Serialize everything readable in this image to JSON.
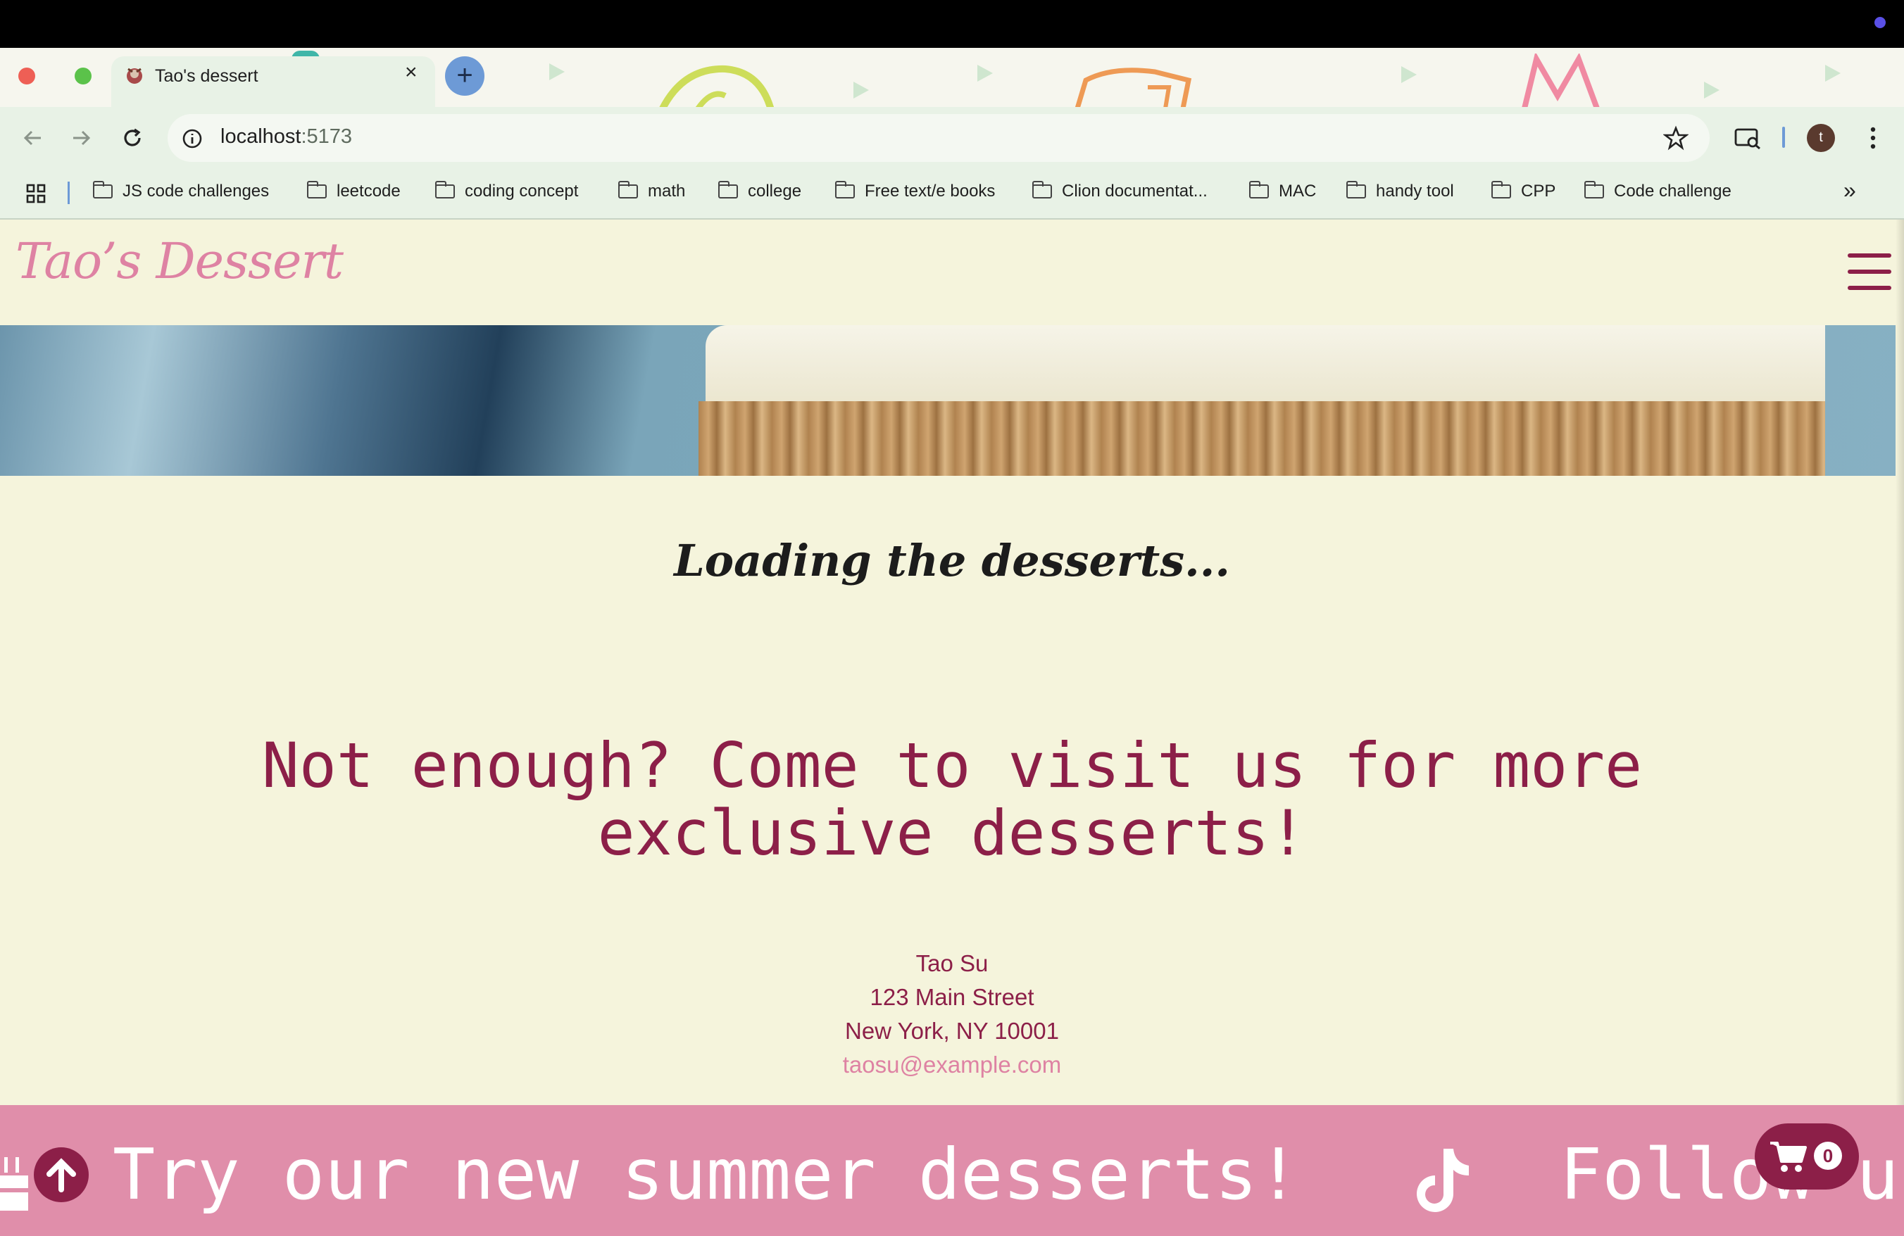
{
  "browser": {
    "tab_title": "Tao's dessert",
    "tab_close": "×",
    "new_tab": "+",
    "url_host": "localhost",
    "url_port": ":5173",
    "bookmarks": [
      "JS code challenges",
      "leetcode",
      "coding concept",
      "math",
      "college",
      "Free text/e books",
      "Clion documentat...",
      "MAC",
      "handy tool",
      "CPP",
      "Code challenge"
    ],
    "more_bookmarks": "»",
    "profile_initial": "t"
  },
  "site": {
    "brand": "Tao’s Dessert",
    "loading": "Loading the desserts...",
    "promo_line1": "Not enough? Come to visit us for more",
    "promo_line2": "exclusive desserts!",
    "contact": {
      "name": "Tao Su",
      "street": "123 Main Street",
      "city": "New York, NY 10001",
      "email": "taosu@example.com"
    },
    "ticker": "Try our new summer desserts!",
    "ticker_next": "Follow us",
    "cart_count": "0"
  },
  "colors": {
    "brand_pink": "#de82a3",
    "maroon": "#8c1f48",
    "footer_pink": "#e08eaa",
    "page_bg": "#f5f4dc"
  }
}
